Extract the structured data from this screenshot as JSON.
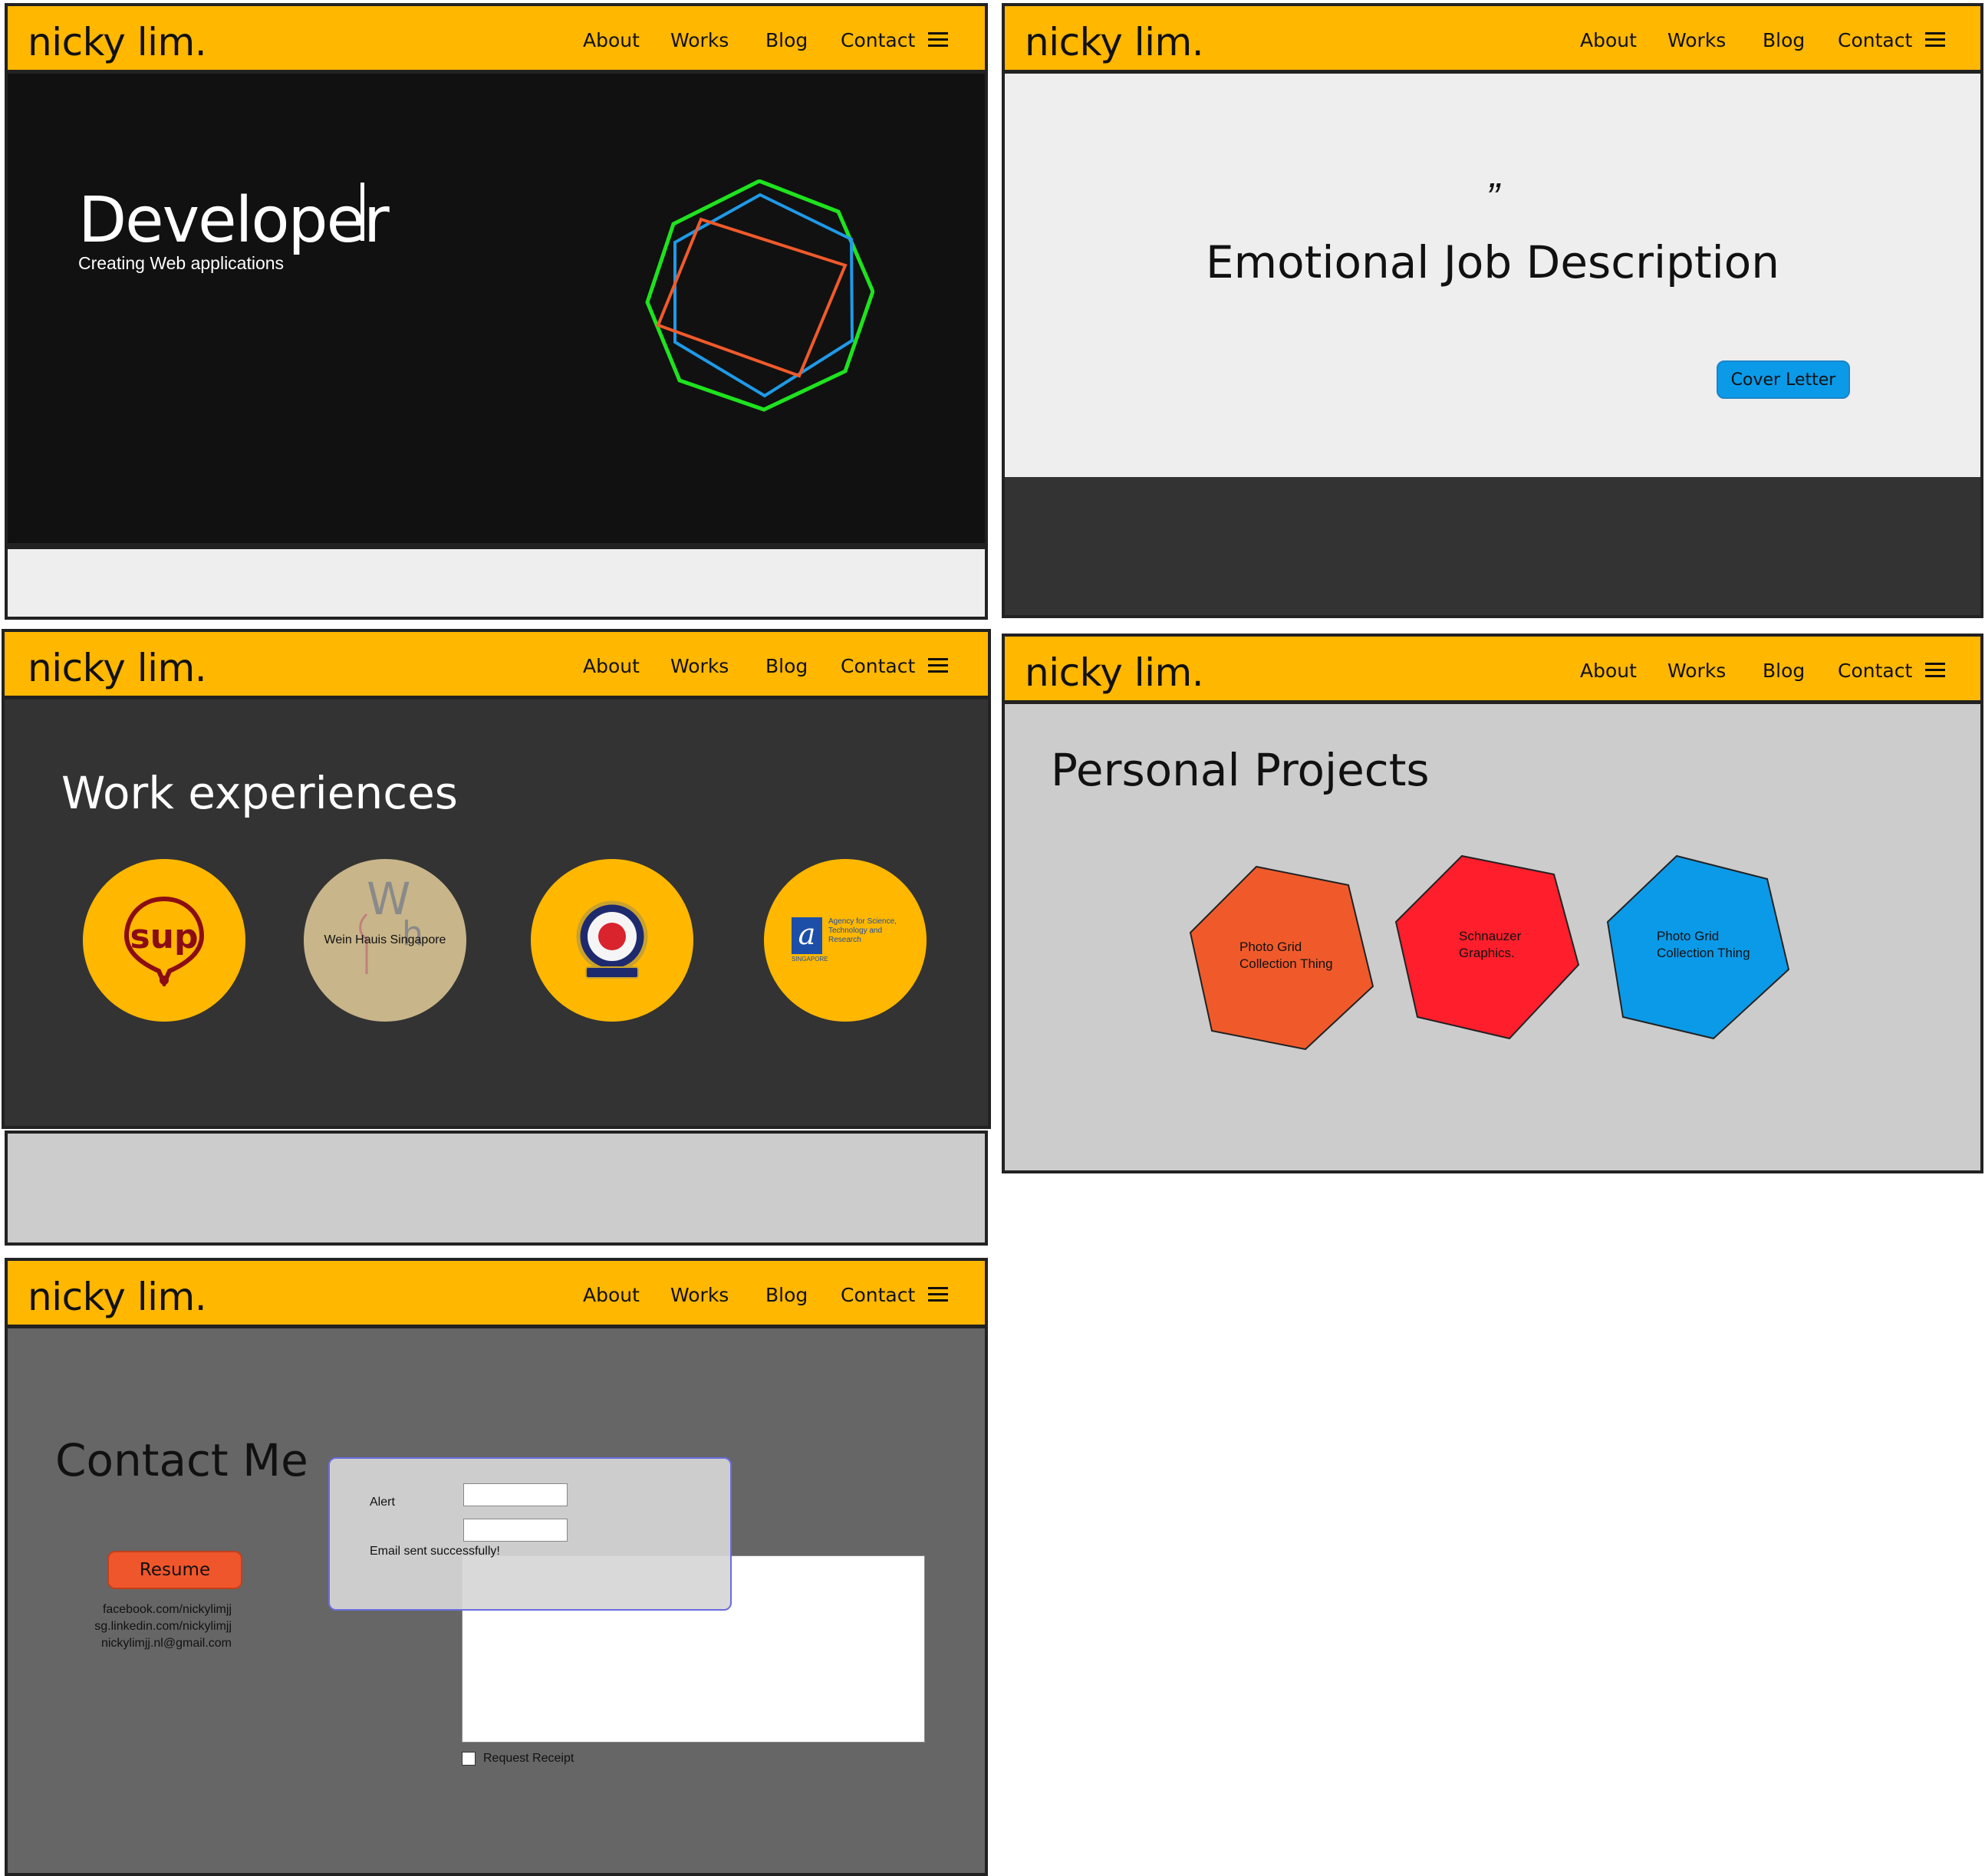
{
  "nav": {
    "brand": "nicky lim.",
    "links": [
      "About",
      "Works",
      "Blog",
      "Contact"
    ],
    "menu_icon": "hamburger-menu-icon"
  },
  "hero": {
    "title": "Developer",
    "subtitle": "Creating Web applications",
    "colors": {
      "background": "#111111",
      "outer_shape": "#1ee31e",
      "middle_shape": "#1f9ae8",
      "inner_shape": "#f05a2b"
    }
  },
  "about": {
    "quote_mark": "”",
    "heading": "Emotional Job Description",
    "button": "Cover Letter"
  },
  "works": {
    "heading": "Work experiences",
    "items": [
      {
        "logo_text": "sup",
        "icon": "sup-location-pin-logo"
      },
      {
        "logo_text": "Wein Hauis Singapore",
        "icon": "wein-haus-logo"
      },
      {
        "icon": "police-crest-logo"
      },
      {
        "logo_text": "Agency for Science, Technology and Research",
        "logo_mark": "a",
        "logo_sub": "SINGAPORE",
        "icon": "astar-logo"
      }
    ]
  },
  "projects": {
    "heading": "Personal Projects",
    "items": [
      {
        "label_1": "Photo Grid",
        "label_2": "Collection Thing",
        "color": "#f05a2b"
      },
      {
        "label_1": "Schnauzer",
        "label_2": "Graphics.",
        "color": "#ff1e2b"
      },
      {
        "label_1": "Photo Grid",
        "label_2": "Collection Thing",
        "color": "#0b9ae8"
      }
    ]
  },
  "contact": {
    "heading": "Contact Me",
    "resume_button": "Resume",
    "links": [
      "facebook.com/nickylimjj",
      "sg.linkedin.com/nickylimjj",
      "nickylimjj.nl@gmail.com"
    ],
    "alert_label": "Alert",
    "alert_message": "Email sent successfully!",
    "checkbox_label": "Request Receipt"
  }
}
